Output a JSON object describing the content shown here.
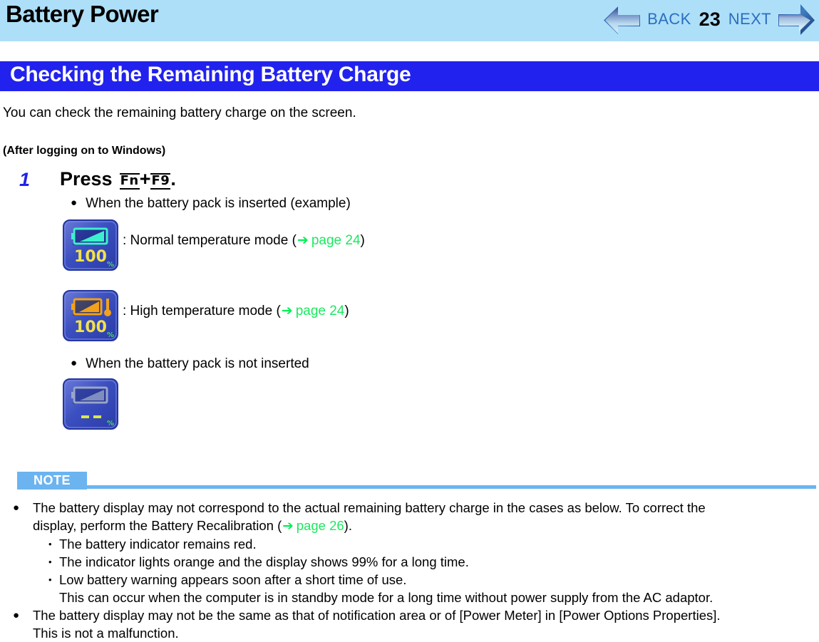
{
  "header": {
    "title": "Battery Power",
    "nav": {
      "back_label": "BACK",
      "page_number": "23",
      "next_label": "NEXT",
      "back_icon": "left-arrow-icon",
      "next_icon": "right-arrow-icon"
    },
    "band_color": "#aedff8"
  },
  "section": {
    "title": "Checking the Remaining Battery Charge",
    "bar_color": "#2222ef",
    "text_color": "#ffffff"
  },
  "body": {
    "intro": "You can check the remaining battery charge on the screen.",
    "subhead": "(After logging on to Windows)",
    "step": {
      "number": "1",
      "press_word": "Press",
      "key1": "Fn",
      "plus": "+",
      "key2": "F9",
      "period": "."
    },
    "bullet_inserted": "When the battery pack is inserted (example)",
    "bullet_not_inserted": "When the battery pack is not inserted",
    "icons": [
      {
        "name": "battery-icon-normal-temp",
        "percent": "100",
        "unit": "%",
        "label_prefix": ": Normal temperature mode (",
        "arrow": "➔",
        "page_ref": "page 24",
        "label_suffix": ")",
        "battery_color": "#3df0cd",
        "text_color": "#f2e14b"
      },
      {
        "name": "battery-icon-high-temp",
        "percent": "100",
        "unit": "%",
        "label_prefix": ": High temperature mode (",
        "arrow": "➔",
        "page_ref": "page 24",
        "label_suffix": ")",
        "battery_color": "#f2a11a",
        "text_color": "#f2e14b"
      },
      {
        "name": "battery-icon-no-battery",
        "percent": "- -",
        "unit": "%",
        "battery_color": "#9aa6c8",
        "text_color": "#d8e84a"
      }
    ]
  },
  "note": {
    "badge": "NOTE",
    "badge_color": "#6cb4f0",
    "items": [
      {
        "bullet": "●",
        "text_line1": "The battery display may not correspond to the actual remaining battery charge in the cases as below. To correct the",
        "text_line2_pre": "display, perform the Battery Recalibration (",
        "arrow": "➔",
        "page_ref": "page 26",
        "text_line2_post": ").",
        "sub_items": [
          "The battery indicator remains red.",
          "The indicator lights orange and the display shows 99% for a long time.",
          "Low battery warning appears soon after a short time of use."
        ],
        "sub_continuation": "This can occur when the computer is in standby mode for a long time without power supply from the AC adaptor."
      },
      {
        "bullet": "●",
        "text_line1": "The battery display may not be the same as that of notification area or of [Power Meter] in [Power Options Properties].",
        "text_line2": "This is not a malfunction."
      }
    ],
    "sub_bullet": "•"
  }
}
